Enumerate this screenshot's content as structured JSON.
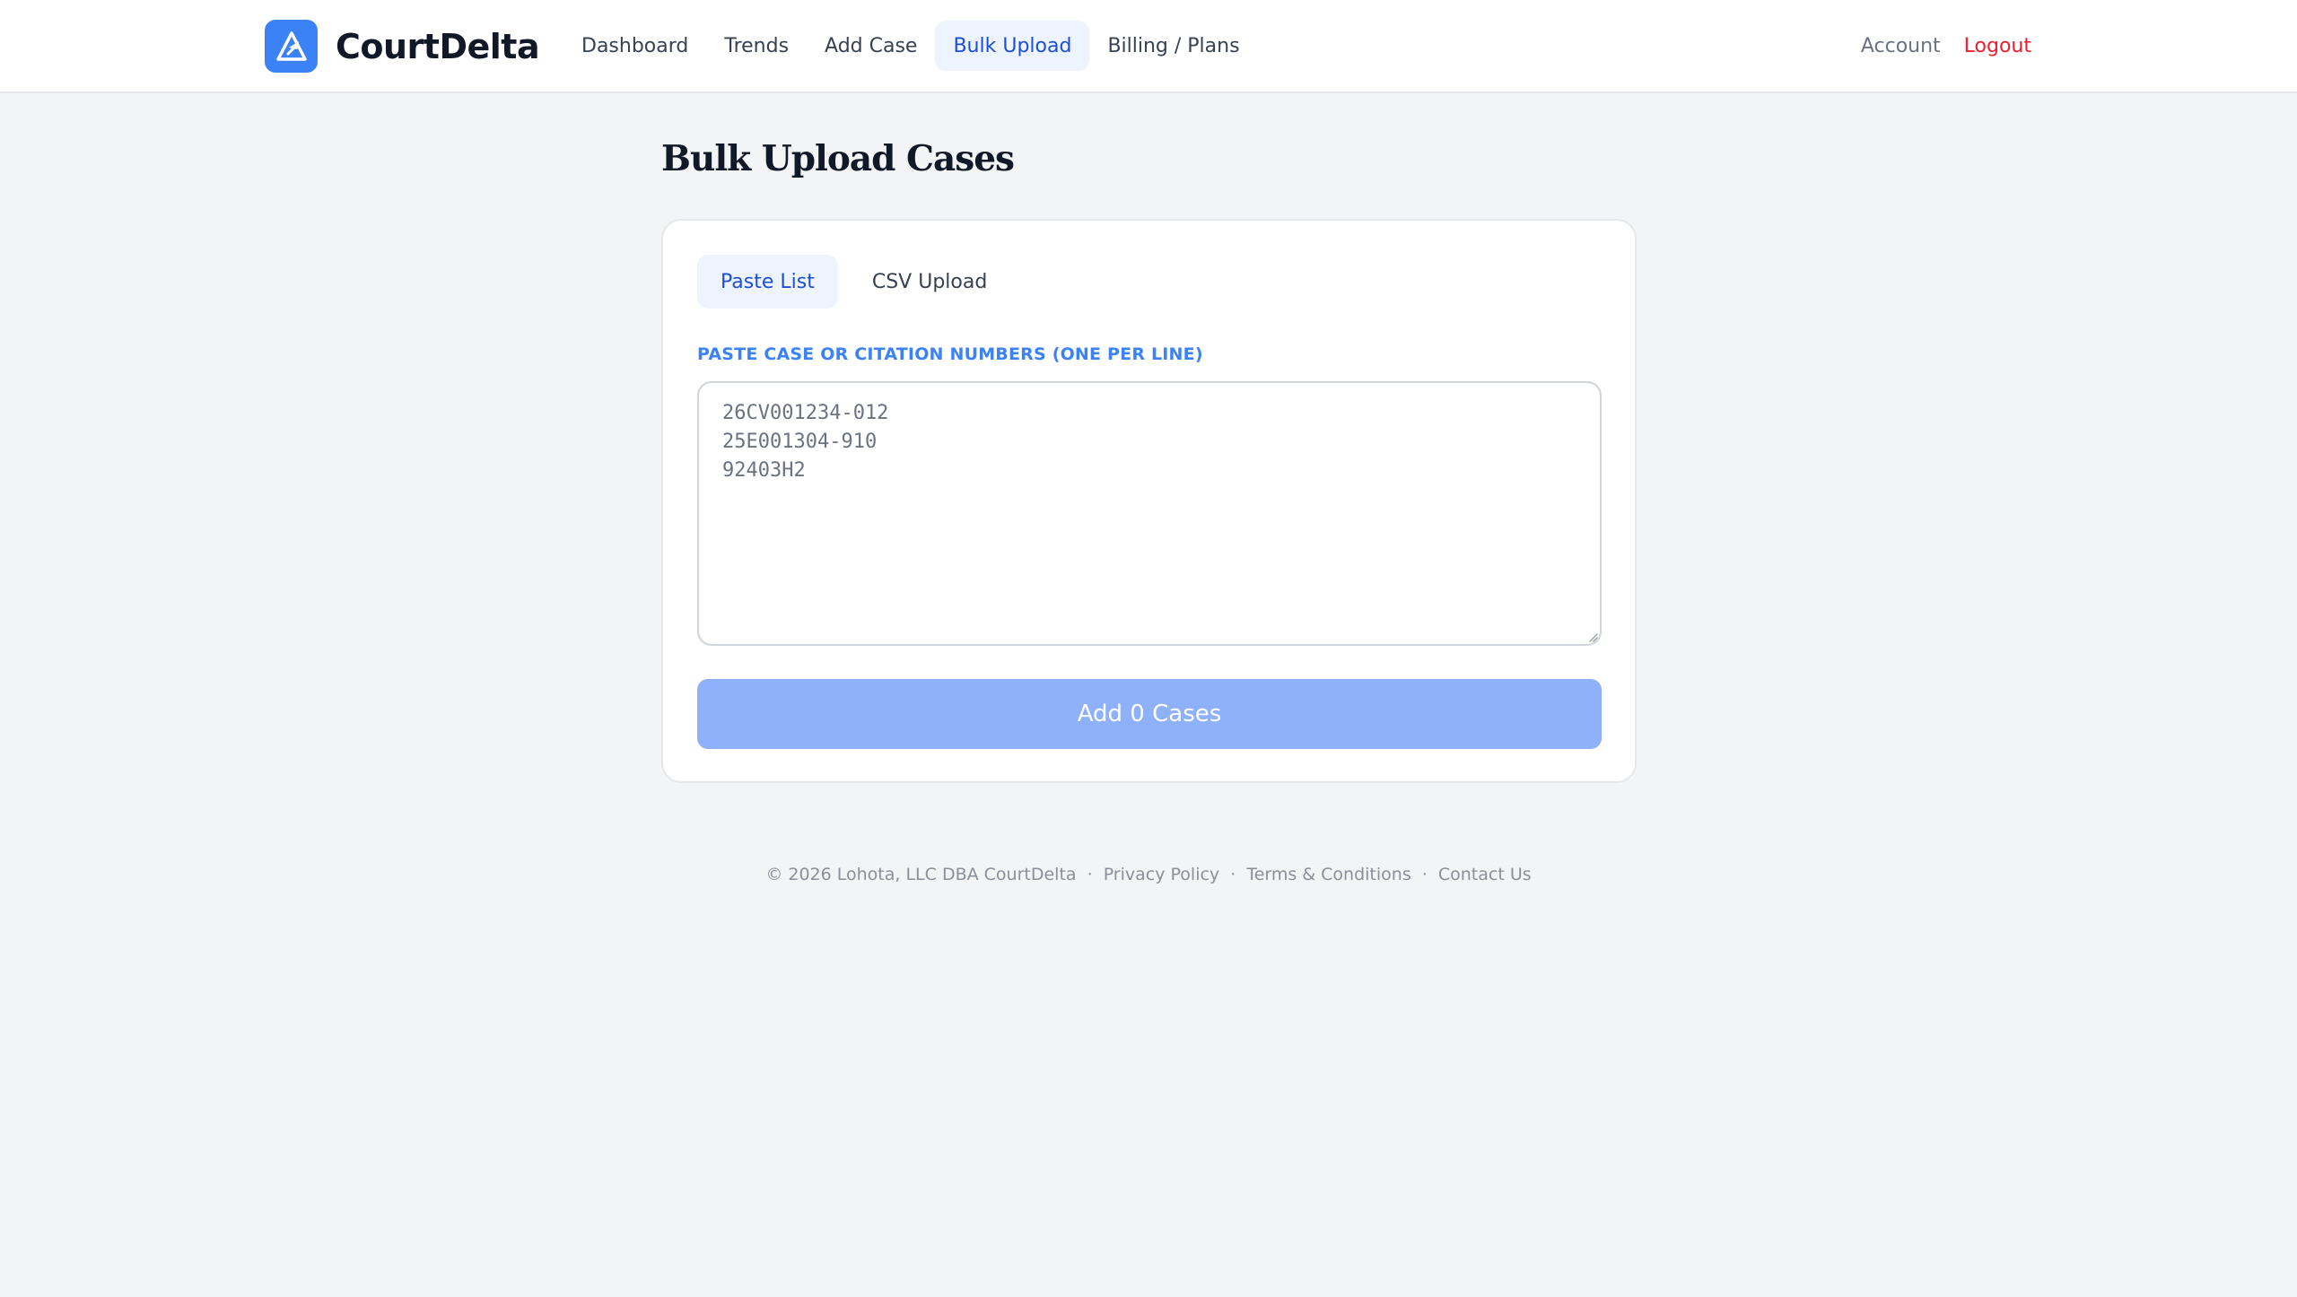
{
  "brand": {
    "name": "CourtDelta",
    "logo_color": "#3b82f6"
  },
  "nav": {
    "items": [
      {
        "label": "Dashboard",
        "active": false
      },
      {
        "label": "Trends",
        "active": false
      },
      {
        "label": "Add Case",
        "active": false
      },
      {
        "label": "Bulk Upload",
        "active": true
      },
      {
        "label": "Billing / Plans",
        "active": false
      }
    ],
    "account_label": "Account",
    "logout_label": "Logout"
  },
  "page": {
    "title": "Bulk Upload Cases"
  },
  "tabs": [
    {
      "label": "Paste List",
      "active": true
    },
    {
      "label": "CSV Upload",
      "active": false
    }
  ],
  "paste_form": {
    "label": "PASTE CASE OR CITATION NUMBERS (ONE PER LINE)",
    "value": "",
    "placeholder": "26CV001234-012\n25E001304-910\n92403H2",
    "submit_label": "Add 0 Cases"
  },
  "footer": {
    "copyright": "© 2026 Lohota, LLC DBA CourtDelta",
    "separator": "·",
    "links": [
      "Privacy Policy",
      "Terms & Conditions",
      "Contact Us"
    ]
  },
  "colors": {
    "accent": "#1d4ed8",
    "accent_light": "#eef4fd",
    "button_disabled": "#8fb1fb",
    "danger": "#ef1f2e",
    "background": "#f2f4f6"
  }
}
